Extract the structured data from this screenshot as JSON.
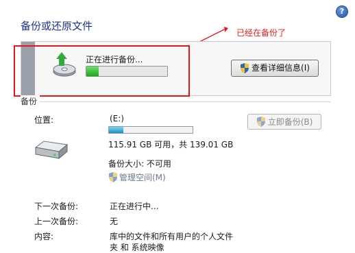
{
  "header": {
    "title": "备份或还原文件",
    "help_icon": "?"
  },
  "annotation": {
    "text": "已经在备份了",
    "color": "#e02020"
  },
  "progress": {
    "status_text": "正在进行备份...",
    "fraction": 0.15,
    "view_details_label": "查看详细信息(I)"
  },
  "backup": {
    "section_label": "备份",
    "location_label": "位置:",
    "location_value": "(E:)",
    "drive_usage_fraction": 0.17,
    "space_text": "115.91 GB 可用，共 139.01 GB",
    "size_label": "备份大小: 不可用",
    "manage_space_label": "管理空间(M)",
    "backup_now_label": "立即备份(B)",
    "next_backup_label": "下一次备份:",
    "next_backup_value": "正在进行中...",
    "last_backup_label": "上一次备份:",
    "last_backup_value": "无",
    "contents_label": "内容:",
    "contents_value_line1": "库中的文件和所有用户的个人文件",
    "contents_value_line2": "夹 和 系统映像"
  },
  "colors": {
    "title": "#1e3287",
    "progress": "#19a619",
    "drive_bar": "#1a8fc2",
    "accent_red": "#e01818"
  }
}
